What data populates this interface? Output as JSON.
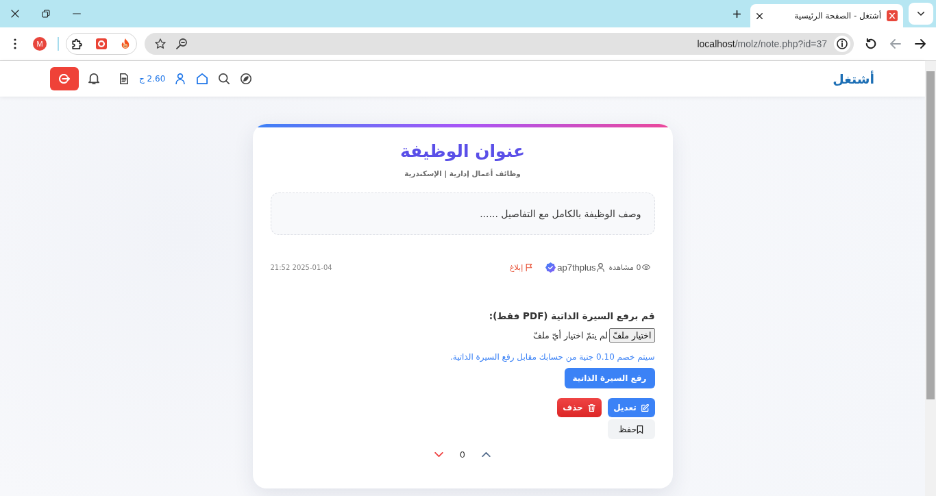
{
  "browser": {
    "tabs": [
      {
        "title": "أشتغل - الصفحة الرئيسية",
        "selected": true
      }
    ],
    "history_buttons": [
      {
        "kind": "back",
        "disabled": false
      },
      {
        "kind": "forward",
        "disabled": true
      }
    ],
    "address": {
      "host": "localhost",
      "path": "/molz/note.php?id=37"
    },
    "profile": {
      "initial": "M"
    }
  },
  "navbar": {
    "brand": "أشتغل",
    "balance": "2.60 ج"
  },
  "card": {
    "title": "عنوان الوظيفة",
    "subtitle": "وظائف أعمال إدارية | الإسكندرية",
    "description": "وصف الوظيفة بالكامل مع التفاصيل ......",
    "meta": {
      "views": "0 مشاهدة",
      "author": "ap7thplus",
      "verified": true,
      "report": "إبلاغ",
      "date": "2025-01-04 21:52"
    },
    "upload": {
      "label": "قم برفع السيرة الذاتية (PDF فقط):",
      "file_button": "اختيار ملفّ",
      "file_status": "لم يتمّ اختيار أيّ ملفّ",
      "note": "سيتم خصم 0.10 جنية من حسابك مقابل رفع السيرة الذاتية.",
      "submit": "رفع السيرة الذاتية"
    },
    "actions": [
      {
        "kind": "edit",
        "label": "تعديل"
      },
      {
        "kind": "delete",
        "label": "حذف"
      },
      {
        "kind": "save",
        "label": "حفظ"
      }
    ],
    "votes": {
      "count": "0"
    }
  }
}
